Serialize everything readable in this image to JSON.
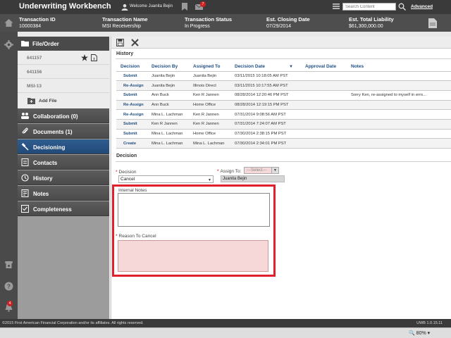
{
  "app": {
    "title": "Underwriting Workbench",
    "welcome": "Welcome Juanita Bejin",
    "mail_count": "7",
    "search_placeholder": "Search Content",
    "advanced_label": "Advanced"
  },
  "summary": {
    "fields": [
      {
        "label": "Transaction ID",
        "value": "10000384"
      },
      {
        "label": "Transaction Name",
        "value": "MSI Receivership"
      },
      {
        "label": "Transaction Status",
        "value": "In Progress"
      },
      {
        "label": "Est. Closing Date",
        "value": "07/29/2014"
      },
      {
        "label": "Est. Total Liability",
        "value": "$61,300,000.00"
      }
    ]
  },
  "sidebar": {
    "header": "File/Order",
    "orders": [
      "641157",
      "641156",
      "MSI-13"
    ],
    "add_file": "Add File",
    "nav": [
      {
        "label": "Collaboration (0)"
      },
      {
        "label": "Documents (1)"
      },
      {
        "label": "Decisioning"
      },
      {
        "label": "Contacts"
      },
      {
        "label": "History"
      },
      {
        "label": "Notes"
      },
      {
        "label": "Completeness"
      }
    ],
    "active_index": 2
  },
  "rail": {
    "bell_count": "4"
  },
  "history": {
    "title": "History",
    "columns": [
      "Decision",
      "Decision By",
      "Assigned To",
      "Decision Date",
      "Approval Date",
      "Notes"
    ],
    "rows": [
      [
        "Submit",
        "Juanita Bejin",
        "Juanita Bejin",
        "03/11/2015 10:18:05 AM PST",
        "",
        ""
      ],
      [
        "Re-Assign",
        "Juanita Bejin",
        "Illinois Direct",
        "03/11/2015 10:17:55 AM PST",
        "",
        ""
      ],
      [
        "Submit",
        "Ann Buck",
        "Ken R Jannen",
        "08/28/2014 12:20:46 PM PST",
        "",
        "Sorry Ken, re-assigned to myself in erro..."
      ],
      [
        "Re-Assign",
        "Ann Buck",
        "Home Office",
        "08/28/2014 12:19:15 PM PST",
        "",
        ""
      ],
      [
        "Re-Assign",
        "Mina L. Lachman",
        "Ken R Jannen",
        "07/31/2014 9:08:56 AM PST",
        "",
        ""
      ],
      [
        "Submit",
        "Ken R Jannen",
        "Ken R Jannen",
        "07/31/2014 7:24:07 AM PST",
        "",
        ""
      ],
      [
        "Submit",
        "Mina L. Lachman",
        "Home Office",
        "07/30/2014 2:38:15 PM PST",
        "",
        ""
      ],
      [
        "Create",
        "Mina L. Lachman",
        "Mina L. Lachman",
        "07/30/2014 2:34:01 PM PST",
        "",
        ""
      ]
    ]
  },
  "decision": {
    "title": "Decision",
    "decision_label": "Decision",
    "decision_value": "Cancel",
    "assign_label": "Assign To:",
    "assign_placeholder": "---Select---",
    "assign_name": "Juanita Bejin",
    "internal_notes_label": "Internal Notes",
    "reason_label": "Reason To Cancel"
  },
  "footer": {
    "copyright": "©2015 First American Financial Corporation and/or its affiliates. All rights reserved.",
    "version": "UWB 1.0.15.11"
  },
  "status": {
    "zoom": "80%"
  },
  "colors": {
    "active_nav": "#2f5c8f",
    "link": "#1f4e80",
    "highlight": "#e0202a",
    "required_bg": "#f6d8d8"
  }
}
